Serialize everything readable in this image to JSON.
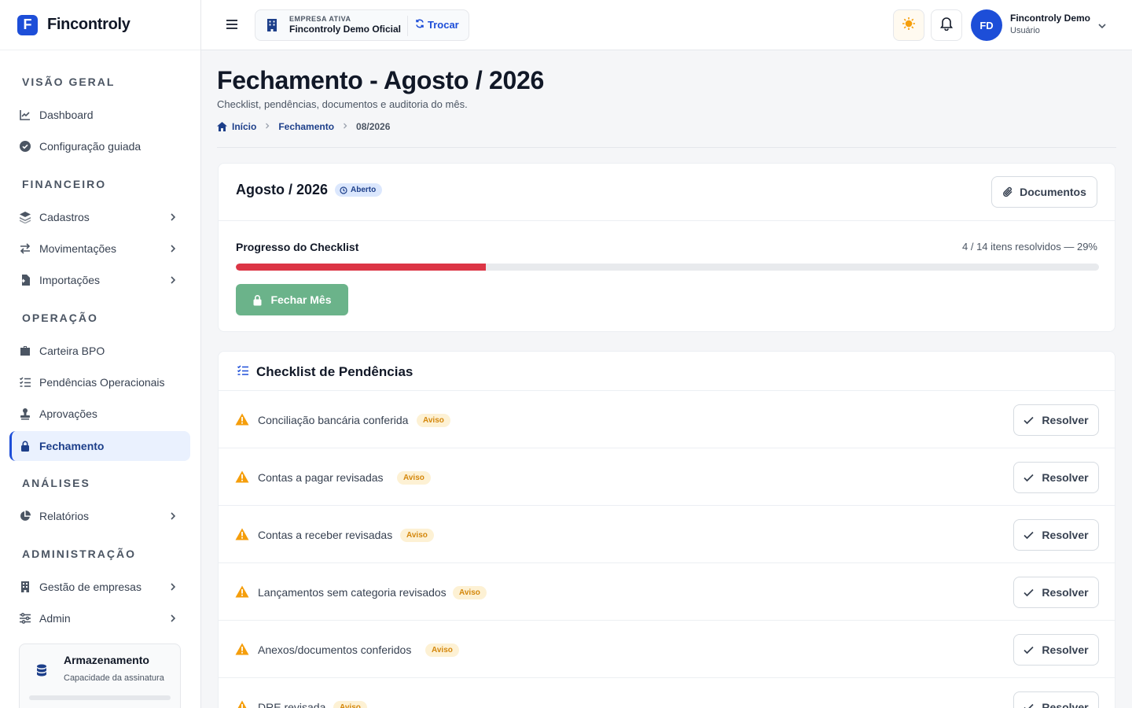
{
  "brand": {
    "logo_letter": "F",
    "name": "Fincontroly"
  },
  "sidebar": {
    "sections": [
      {
        "title": "VISÃO GERAL"
      },
      {
        "title": "FINANCEIRO"
      },
      {
        "title": "OPERAÇÃO"
      },
      {
        "title": "ANÁLISES"
      },
      {
        "title": "ADMINISTRAÇÃO"
      }
    ],
    "items": [
      {
        "label": "Dashboard",
        "icon": "chart-line-icon"
      },
      {
        "label": "Configuração guiada",
        "icon": "check-circle-icon"
      },
      {
        "label": "Cadastros",
        "icon": "layers-icon",
        "has_children": true
      },
      {
        "label": "Movimentações",
        "icon": "arrows-swap-icon",
        "has_children": true
      },
      {
        "label": "Importações",
        "icon": "file-import-icon",
        "has_children": true
      },
      {
        "label": "Carteira BPO",
        "icon": "briefcase-icon"
      },
      {
        "label": "Pendências Operacionais",
        "icon": "list-check-icon"
      },
      {
        "label": "Aprovações",
        "icon": "stamp-icon"
      },
      {
        "label": "Fechamento",
        "icon": "lock-icon",
        "active": true
      },
      {
        "label": "Relatórios",
        "icon": "pie-chart-icon",
        "has_children": true
      },
      {
        "label": "Gestão de empresas",
        "icon": "building-icon",
        "has_children": true
      },
      {
        "label": "Admin",
        "icon": "sliders-icon",
        "has_children": true
      }
    ],
    "storage": {
      "title": "Armazenamento",
      "subtitle": "Capacidade da assinatura",
      "icon": "database-icon"
    }
  },
  "topbar": {
    "company_label": "EMPRESA ATIVA",
    "company_name": "Fincontroly Demo Oficial",
    "switch_label": "Trocar",
    "user": {
      "initials": "FD",
      "name": "Fincontroly Demo",
      "role": "Usuário"
    }
  },
  "page": {
    "title": "Fechamento - Agosto / 2026",
    "subtitle": "Checklist, pendências, documentos e auditoria do mês.",
    "breadcrumb": [
      "Início",
      "Fechamento",
      "08/2026"
    ]
  },
  "period_card": {
    "title": "Agosto / 2026",
    "status": "Aberto",
    "documents_button": "Documentos",
    "progress_label": "Progresso do Checklist",
    "progress_text": "4 / 14 itens resolvidos — 29%",
    "progress_fraction": 0.29,
    "close_button": "Fechar Mês"
  },
  "checklist": {
    "title": "Checklist de Pendências",
    "resolve_label": "Resolver",
    "items": [
      {
        "label": "Conciliação bancária conferida",
        "badge": "Aviso"
      },
      {
        "label": "Contas a pagar revisadas",
        "badge": "Aviso"
      },
      {
        "label": "Contas a receber revisadas",
        "badge": "Aviso"
      },
      {
        "label": "Lançamentos sem categoria revisados",
        "badge": "Aviso"
      },
      {
        "label": "Anexos/documentos conferidos",
        "badge": "Aviso"
      },
      {
        "label": "DRE revisada",
        "badge": "Aviso"
      }
    ]
  },
  "colors": {
    "accent": "#1d4ed8",
    "progress_fill": "#dc3545",
    "close_button": "#6bb38a",
    "warning": "#f59e0b",
    "theme_toggle": "#f59e0b"
  }
}
